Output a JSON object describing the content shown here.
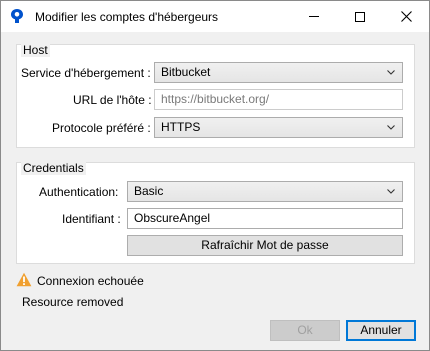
{
  "window": {
    "title": "Modifier les comptes d'hébergeurs"
  },
  "host": {
    "legend": "Host",
    "service_label": "Service d'hébergement :",
    "service_value": "Bitbucket",
    "url_label": "URL de l'hôte :",
    "url_placeholder": "https://bitbucket.org/",
    "protocol_label": "Protocole préféré :",
    "protocol_value": "HTTPS"
  },
  "credentials": {
    "legend": "Credentials",
    "auth_label": "Authentication:",
    "auth_value": "Basic",
    "username_label": "Identifiant :",
    "username_value": "ObscureAngel",
    "refresh_label": "Rafraîchir Mot de passe"
  },
  "status": {
    "warning_text": "Connexion echouée",
    "message": "Resource removed"
  },
  "buttons": {
    "ok_label": "Ok",
    "cancel_label": "Annuler"
  },
  "colors": {
    "accent": "#0078d7",
    "warning": "#f0a030"
  }
}
